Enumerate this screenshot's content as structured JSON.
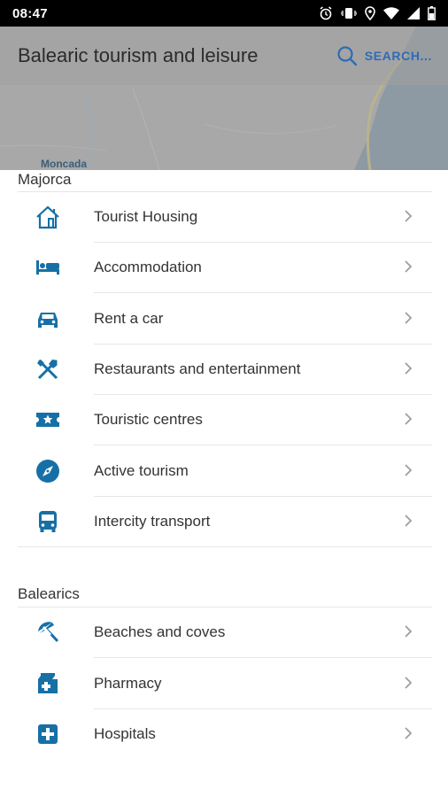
{
  "status_bar": {
    "time": "08:47"
  },
  "header": {
    "title": "Balearic tourism and leisure",
    "search_label": "SEARCH..."
  },
  "map": {
    "place_label": "Moncada"
  },
  "colors": {
    "accent": "#1670a6",
    "search": "#2e6bb8"
  },
  "sections": [
    {
      "title": "Majorca",
      "items": [
        {
          "label": "Tourist Housing",
          "icon": "house-icon"
        },
        {
          "label": "Accommodation",
          "icon": "bed-icon"
        },
        {
          "label": "Rent a car",
          "icon": "car-icon"
        },
        {
          "label": "Restaurants and entertainment",
          "icon": "cutlery-icon"
        },
        {
          "label": "Touristic centres",
          "icon": "ticket-star-icon"
        },
        {
          "label": "Active tourism",
          "icon": "compass-icon"
        },
        {
          "label": "Intercity transport",
          "icon": "bus-icon"
        }
      ]
    },
    {
      "title": "Balearics",
      "items": [
        {
          "label": "Beaches and coves",
          "icon": "beach-umbrella-icon"
        },
        {
          "label": "Pharmacy",
          "icon": "pharmacy-icon"
        },
        {
          "label": "Hospitals",
          "icon": "hospital-cross-icon"
        }
      ]
    }
  ]
}
